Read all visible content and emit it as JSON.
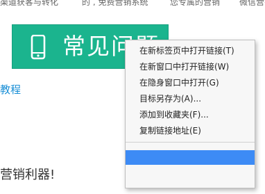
{
  "top_strip": {
    "fragments": [
      "渠道获客与转化",
      "的 , 免费营销系统",
      "您专属的营销",
      "微信营销"
    ]
  },
  "faq_banner": {
    "title": "常见问题",
    "icon": "phone-icon",
    "background": "#1bb48e"
  },
  "tutorial_link": "教程",
  "bottom_text": "营销利器!",
  "context_menu": {
    "items": [
      "在新标签页中打开链接(T)",
      "在新窗口中打开链接(W)",
      "在隐身窗口中打开(G)",
      "目标另存为(A)...",
      "添加到收藏夹(F)...",
      "复制链接地址(E)"
    ],
    "highlight_color": "#3d8bf5"
  }
}
